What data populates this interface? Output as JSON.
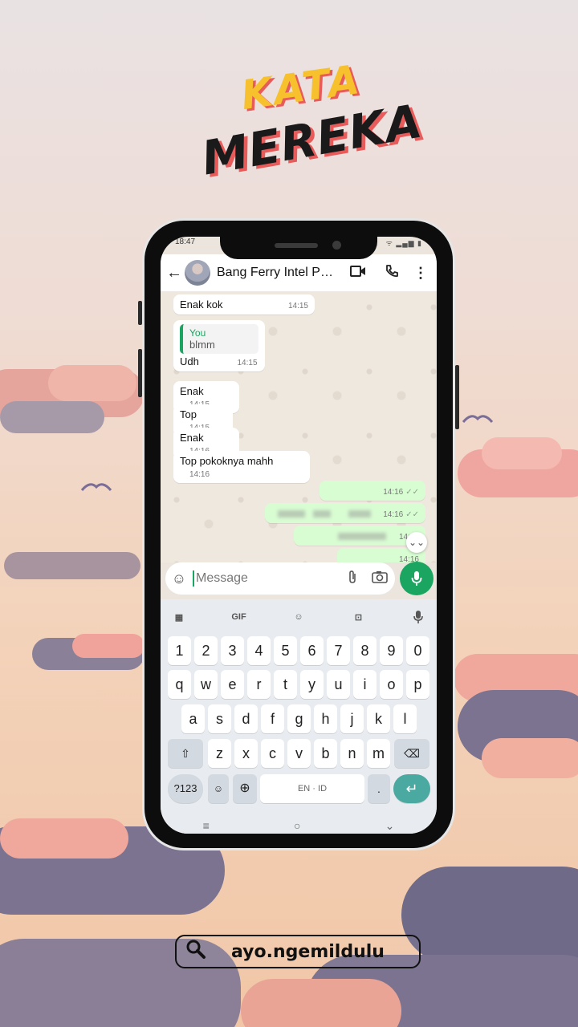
{
  "poster": {
    "headline_top": "KATA",
    "headline_bottom": "MEREKA",
    "handle": "ayo.ngemildulu"
  },
  "status_bar": {
    "time": "18:47",
    "icons": "ᯤ ▂▄▆ ▮"
  },
  "header": {
    "contact_name": "Bang Ferry Intel P…"
  },
  "messages": [
    {
      "text": "Enak kok",
      "time": "14:15"
    },
    {
      "reply_sender": "You",
      "reply_text": "blmm",
      "text": "Udh",
      "time": "14:15"
    },
    {
      "text": "Enak",
      "time": "14:15"
    },
    {
      "text": "Top",
      "time": "14:15"
    },
    {
      "text": "Enak",
      "time": "14:16"
    },
    {
      "text": "Top pokoknya mahh",
      "time": "14:16"
    }
  ],
  "outgoing": [
    {
      "time": "14:16"
    },
    {
      "time": "14:16"
    },
    {
      "time": "14:16"
    },
    {
      "time": "14:16"
    }
  ],
  "composer": {
    "placeholder": "Message"
  },
  "keyboard": {
    "toolbar": [
      "GIF"
    ],
    "row_numbers": [
      "1",
      "2",
      "3",
      "4",
      "5",
      "6",
      "7",
      "8",
      "9",
      "0"
    ],
    "row1": [
      "q",
      "w",
      "e",
      "r",
      "t",
      "y",
      "u",
      "i",
      "o",
      "p"
    ],
    "row2": [
      "a",
      "s",
      "d",
      "f",
      "g",
      "h",
      "j",
      "k",
      "l"
    ],
    "row3": [
      "z",
      "x",
      "c",
      "v",
      "b",
      "n",
      "m"
    ],
    "symbols_key": "?123",
    "space_label": "EN · ID",
    "period": "."
  },
  "colors": {
    "whatsapp_green": "#1aa561",
    "outgoing_bubble": "#d9fdd3",
    "headline_yellow": "#f6c12c",
    "headline_shadow": "#e85b5b"
  }
}
